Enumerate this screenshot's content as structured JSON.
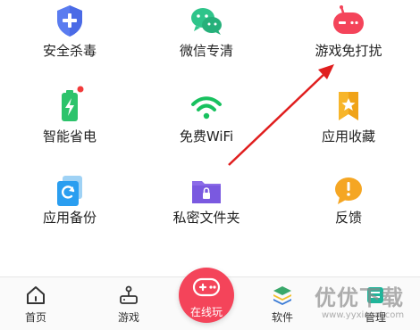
{
  "grid": {
    "items": [
      {
        "label": "安全杀毒",
        "icon": "shield-plus-icon"
      },
      {
        "label": "微信专清",
        "icon": "wechat-icon"
      },
      {
        "label": "游戏免打扰",
        "icon": "gamepad-icon"
      },
      {
        "label": "智能省电",
        "icon": "battery-icon"
      },
      {
        "label": "免费WiFi",
        "icon": "wifi-icon"
      },
      {
        "label": "应用收藏",
        "icon": "bookmark-star-icon"
      },
      {
        "label": "应用备份",
        "icon": "backup-icon"
      },
      {
        "label": "私密文件夹",
        "icon": "lock-folder-icon"
      },
      {
        "label": "反馈",
        "icon": "feedback-icon"
      }
    ]
  },
  "tabbar": {
    "home": "首页",
    "games": "游戏",
    "online_play": "在线玩",
    "software": "软件",
    "manage": "管理"
  },
  "watermark": {
    "text": "优优下载",
    "url": "www.yyxiazai.com"
  },
  "colors": {
    "accent_red": "#f4445a",
    "annotation_arrow": "#e01e1e",
    "shield_blue": "#5a7cf0",
    "wechat_green": "#2ec48a",
    "wifi_green": "#18c15f"
  }
}
